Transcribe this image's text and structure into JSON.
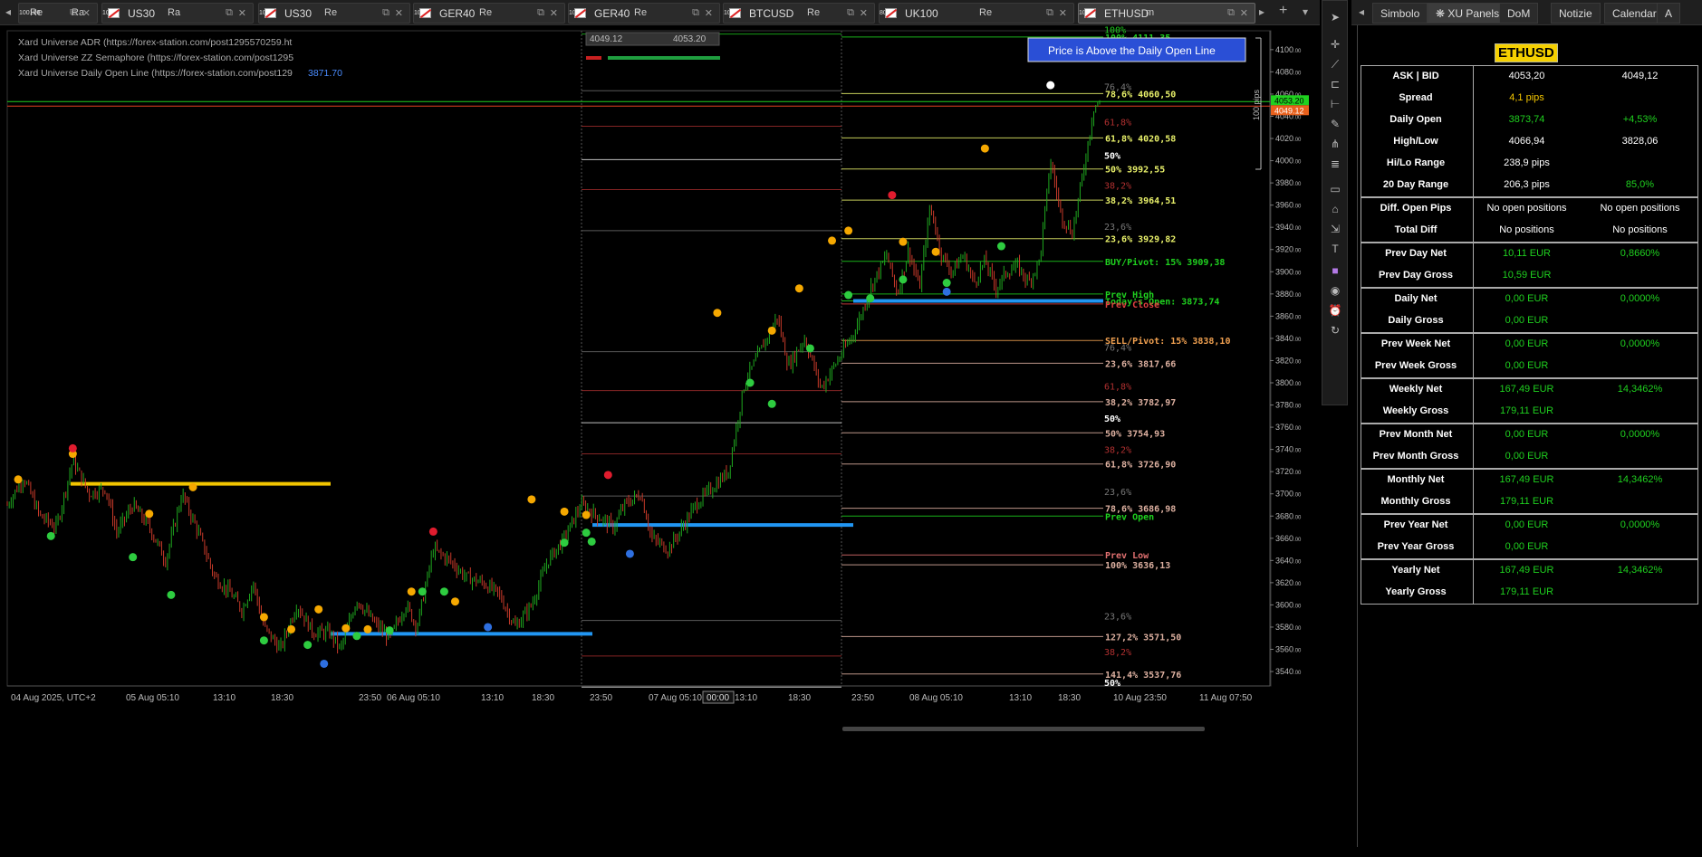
{
  "tabs": [
    {
      "symbol": "",
      "period": "Re",
      "period_sub": "100",
      "period2": "Ra",
      "period2_sub": "100"
    },
    {
      "symbol": "US30",
      "period": "Ra",
      "period_sub": "100",
      "period2": "",
      "period2_sub": ""
    },
    {
      "symbol": "US30",
      "period": "Re",
      "period_sub": "100",
      "period2": "",
      "period2_sub": ""
    },
    {
      "symbol": "GER40",
      "period": "Re",
      "period_sub": "100",
      "period2": "",
      "period2_sub": ""
    },
    {
      "symbol": "GER40",
      "period": "Re",
      "period_sub": "100",
      "period2": "",
      "period2_sub": ""
    },
    {
      "symbol": "BTCUSD",
      "period": "Re",
      "period_sub": "100",
      "period2": "",
      "period2_sub": ""
    },
    {
      "symbol": "UK100",
      "period": "Re",
      "period_sub": "80",
      "period2": "",
      "period2_sub": ""
    },
    {
      "symbol": "ETHUSD",
      "period": "m",
      "period_sub": "10",
      "period2": "",
      "period2_sub": ""
    }
  ],
  "right_tabs": [
    "Simbolo",
    "XU Panels",
    "DoM",
    "Notizie",
    "Calendario",
    "A"
  ],
  "indicators": [
    {
      "name": "Xard Universe ADR (https://forex-station.com/post1295570259.ht",
      "value": ""
    },
    {
      "name": "Xard Universe ZZ Semaphore (https://forex-station.com/post1295",
      "value": ""
    },
    {
      "name": "Xard Universe Daily Open Line (https://forex-station.com/post129",
      "value": "3871.70"
    }
  ],
  "trade_box": {
    "sell": "4049.",
    "sell_sub": "12",
    "buy": "4053.",
    "buy_sub": "20"
  },
  "alert_banner": "Price is Above the Daily Open Line",
  "pips_label": "100 pips",
  "price_tags": {
    "ask": "4053.20",
    "bid": "4049.12"
  },
  "crosshair_time": "00:00",
  "chart_data": {
    "type": "candlestick",
    "symbol": "ETHUSD",
    "timezone": "UTC+2",
    "ylim": [
      3527,
      4117
    ],
    "y_ticks": [
      4100,
      4080,
      4060,
      4040,
      4020,
      4000,
      3980,
      3960,
      3940,
      3920,
      3900,
      3880,
      3860,
      3840,
      3820,
      3800,
      3780,
      3760,
      3740,
      3720,
      3700,
      3680,
      3660,
      3640,
      3620,
      3600,
      3580,
      3560,
      3540
    ],
    "x_ticks": [
      "04 Aug 2025, UTC+2",
      "05 Aug 05:10",
      "13:10",
      "18:30",
      "23:50",
      "06 Aug 05:10",
      "13:10",
      "18:30",
      "23:50",
      "07 Aug 05:10",
      "13:10",
      "18:30",
      "23:50",
      "08 Aug 05:10",
      "13:10",
      "18:30",
      "10 Aug 23:50",
      "11 Aug 07:50"
    ],
    "close_path": [
      [
        0,
        3690
      ],
      [
        0.015,
        3715
      ],
      [
        0.03,
        3680
      ],
      [
        0.045,
        3670
      ],
      [
        0.06,
        3730
      ],
      [
        0.075,
        3700
      ],
      [
        0.09,
        3705
      ],
      [
        0.1,
        3665
      ],
      [
        0.115,
        3690
      ],
      [
        0.13,
        3670
      ],
      [
        0.145,
        3640
      ],
      [
        0.16,
        3700
      ],
      [
        0.175,
        3665
      ],
      [
        0.19,
        3625
      ],
      [
        0.205,
        3610
      ],
      [
        0.215,
        3595
      ],
      [
        0.225,
        3620
      ],
      [
        0.235,
        3580
      ],
      [
        0.25,
        3560
      ],
      [
        0.265,
        3600
      ],
      [
        0.28,
        3575
      ],
      [
        0.295,
        3575
      ],
      [
        0.305,
        3560
      ],
      [
        0.32,
        3605
      ],
      [
        0.335,
        3585
      ],
      [
        0.35,
        3570
      ],
      [
        0.365,
        3600
      ],
      [
        0.375,
        3580
      ],
      [
        0.39,
        3650
      ],
      [
        0.405,
        3640
      ],
      [
        0.42,
        3625
      ],
      [
        0.435,
        3620
      ],
      [
        0.45,
        3610
      ],
      [
        0.465,
        3580
      ],
      [
        0.48,
        3600
      ],
      [
        0.495,
        3640
      ],
      [
        0.51,
        3660
      ],
      [
        0.525,
        3690
      ],
      [
        0.54,
        3680
      ],
      [
        0.555,
        3670
      ],
      [
        0.565,
        3690
      ],
      [
        0.58,
        3700
      ],
      [
        0.59,
        3660
      ],
      [
        0.605,
        3650
      ],
      [
        0.615,
        3665
      ],
      [
        0.63,
        3690
      ],
      [
        0.645,
        3705
      ],
      [
        0.66,
        3720
      ],
      [
        0.675,
        3800
      ],
      [
        0.69,
        3830
      ],
      [
        0.705,
        3860
      ],
      [
        0.715,
        3815
      ],
      [
        0.73,
        3840
      ],
      [
        0.745,
        3795
      ],
      [
        0.76,
        3820
      ],
      [
        0.775,
        3845
      ],
      [
        0.785,
        3870
      ],
      [
        0.79,
        3885
      ],
      [
        0.805,
        3915
      ],
      [
        0.815,
        3880
      ],
      [
        0.825,
        3920
      ],
      [
        0.835,
        3885
      ],
      [
        0.845,
        3960
      ],
      [
        0.855,
        3915
      ],
      [
        0.865,
        3900
      ],
      [
        0.875,
        3915
      ],
      [
        0.885,
        3890
      ],
      [
        0.895,
        3910
      ],
      [
        0.905,
        3885
      ],
      [
        0.915,
        3900
      ],
      [
        0.925,
        3905
      ],
      [
        0.935,
        3890
      ],
      [
        0.945,
        3910
      ],
      [
        0.955,
        4000
      ],
      [
        0.965,
        3950
      ],
      [
        0.975,
        3935
      ],
      [
        0.985,
        3990
      ],
      [
        0.995,
        4050
      ],
      [
        1,
        4052
      ]
    ],
    "yellow_dots": [
      [
        3713,
        "0.01"
      ],
      [
        3736,
        "0.06"
      ],
      [
        3682,
        "0.13"
      ],
      [
        3706,
        "0.17"
      ],
      [
        3589,
        "0.235"
      ],
      [
        3578,
        "0.26"
      ],
      [
        3596,
        "0.285"
      ],
      [
        3579,
        "0.31"
      ],
      [
        3578,
        "0.33"
      ],
      [
        3612,
        "0.37"
      ],
      [
        3603,
        "0.41"
      ],
      [
        3695,
        "0.48"
      ],
      [
        3684,
        "0.51"
      ],
      [
        3681,
        "0.53"
      ],
      [
        3863,
        "0.65"
      ],
      [
        3847,
        "0.7"
      ],
      [
        3885,
        "0.725"
      ],
      [
        3928,
        "0.755"
      ],
      [
        3937,
        "0.77"
      ],
      [
        3927,
        "0.82"
      ],
      [
        3918,
        "0.85"
      ],
      [
        4011,
        "0.895"
      ]
    ],
    "red_dots": [
      [
        3741,
        "0.06"
      ],
      [
        3666,
        "0.39"
      ],
      [
        3717,
        "0.55"
      ],
      [
        3969,
        "0.81"
      ]
    ],
    "green_dots": [
      [
        3662,
        "0.04"
      ],
      [
        3643,
        "0.115"
      ],
      [
        3609,
        "0.15"
      ],
      [
        3568,
        "0.235"
      ],
      [
        3564,
        "0.275"
      ],
      [
        3572,
        "0.32"
      ],
      [
        3577,
        "0.35"
      ],
      [
        3612,
        "0.38"
      ],
      [
        3612,
        "0.4"
      ],
      [
        3656,
        "0.51"
      ],
      [
        3665,
        "0.53"
      ],
      [
        3657,
        "0.535"
      ],
      [
        3800,
        "0.68"
      ],
      [
        3781,
        "0.7"
      ],
      [
        3831,
        "0.735"
      ],
      [
        3879,
        "0.77"
      ],
      [
        3876,
        "0.79"
      ],
      [
        3893,
        "0.82"
      ],
      [
        3890,
        "0.86"
      ],
      [
        3923,
        "0.91"
      ]
    ],
    "blue_dots": [
      [
        3547,
        "0.29"
      ],
      [
        3580,
        "0.44"
      ],
      [
        3646,
        "0.57"
      ],
      [
        3882,
        "0.86"
      ]
    ],
    "white_dots": [
      [
        4068,
        "0.955"
      ]
    ],
    "fib_right": [
      {
        "label": "100% 4111,35",
        "price": 4111.35,
        "color": "#1fd11f"
      },
      {
        "label": "78,6% 4060,50",
        "price": 4060.5,
        "color": "#e8f06a"
      },
      {
        "label": "61,8% 4020,58",
        "price": 4020.58,
        "color": "#e8f06a"
      },
      {
        "label": "50% 3992,55",
        "price": 3992.55,
        "color": "#e8f06a"
      },
      {
        "label": "38,2% 3964,51",
        "price": 3964.51,
        "color": "#e8f06a"
      },
      {
        "label": "23,6% 3929,82",
        "price": 3929.82,
        "color": "#e8f06a"
      },
      {
        "label": "BUY/Pivot: 15% 3909,38",
        "price": 3909.38,
        "color": "#1fd11f"
      },
      {
        "label": "Prev High",
        "price": 3880,
        "color": "#1fd11f"
      },
      {
        "label": "Today's Open: 3873,74",
        "price": 3873.74,
        "color": "#1fd11f"
      },
      {
        "label": "Prev Close",
        "price": 3871,
        "color": "#e04040"
      },
      {
        "label": "SELL/Pivot: 15% 3838,10",
        "price": 3838.1,
        "color": "#f0a050"
      },
      {
        "label": "23,6% 3817,66",
        "price": 3817.66,
        "color": "#ddb0a0"
      },
      {
        "label": "38,2% 3782,97",
        "price": 3782.97,
        "color": "#ddb0a0"
      },
      {
        "label": "50% 3754,93",
        "price": 3754.93,
        "color": "#ddb0a0"
      },
      {
        "label": "61,8% 3726,90",
        "price": 3726.9,
        "color": "#ddb0a0"
      },
      {
        "label": "78,6% 3686,98",
        "price": 3686.98,
        "color": "#ddb0a0"
      },
      {
        "label": "Prev Open",
        "price": 3680,
        "color": "#1fd11f"
      },
      {
        "label": "Prev Low",
        "price": 3645,
        "color": "#e07070"
      },
      {
        "label": "100% 3636,13",
        "price": 3636.13,
        "color": "#ddb0a0"
      },
      {
        "label": "127,2% 3571,50",
        "price": 3571.5,
        "color": "#ddb0a0"
      },
      {
        "label": "141,4% 3537,76",
        "price": 3537.76,
        "color": "#ddb0a0"
      }
    ],
    "fib_left": [
      {
        "label": "100%",
        "price": 4114,
        "color": "#1fd11f"
      },
      {
        "label": "76,4%",
        "price": 4063,
        "color": "#777"
      },
      {
        "label": "61,8%",
        "price": 4031,
        "color": "#b03030"
      },
      {
        "label": "50%",
        "price": 4001,
        "color": "#fff"
      },
      {
        "label": "38,2%",
        "price": 3974,
        "color": "#b03030"
      },
      {
        "label": "23,6%",
        "price": 3937,
        "color": "#777"
      },
      {
        "label": "76,4%",
        "price": 3828,
        "color": "#777"
      },
      {
        "label": "61,8%",
        "price": 3793,
        "color": "#b03030"
      },
      {
        "label": "50%",
        "price": 3764,
        "color": "#fff"
      },
      {
        "label": "38,2%",
        "price": 3736,
        "color": "#b03030"
      },
      {
        "label": "23,6%",
        "price": 3698,
        "color": "#777"
      },
      {
        "label": "23,6%",
        "price": 3586,
        "color": "#777"
      },
      {
        "label": "38,2%",
        "price": 3554,
        "color": "#b03030"
      },
      {
        "label": "50%",
        "price": 3526,
        "color": "#fff"
      }
    ],
    "daily_open_lines": [
      {
        "price": 3709,
        "color": "#f2c500"
      },
      {
        "price": 3574,
        "color": "#2196f3"
      },
      {
        "price": 3672,
        "color": "#2196f3"
      },
      {
        "price": 3873.74,
        "color": "#2196f3"
      }
    ]
  },
  "panel": {
    "title": "ETHUSD",
    "groups": [
      [
        {
          "label": "ASK | BID",
          "v1": "4053,20",
          "v2": "4049,12",
          "c1": "w",
          "c2": "w"
        },
        {
          "label": "Spread",
          "v1": "4,1 pips",
          "v2": "",
          "c1": "y",
          "c2": ""
        },
        {
          "label": "Daily Open",
          "v1": "3873,74",
          "v2": "+4,53%",
          "c1": "g",
          "c2": "g"
        },
        {
          "label": "High/Low",
          "v1": "4066,94",
          "v2": "3828,06",
          "c1": "w",
          "c2": "w"
        },
        {
          "label": "Hi/Lo Range",
          "v1": "238,9 pips",
          "v2": "",
          "c1": "w",
          "c2": ""
        },
        {
          "label": "20 Day Range",
          "v1": "206,3 pips",
          "v2": "85,0%",
          "c1": "w",
          "c2": "g"
        }
      ],
      [
        {
          "label": "Diff. Open Pips",
          "v1": "No open positions",
          "v2": "No open positions",
          "c1": "w",
          "c2": "w"
        },
        {
          "label": "Total Diff",
          "v1": "No positions",
          "v2": "No positions",
          "c1": "w",
          "c2": "w"
        }
      ],
      [
        {
          "label": "Prev Day Net",
          "v1": "10,11 EUR",
          "v2": "0,8660%",
          "c1": "g",
          "c2": "g"
        },
        {
          "label": "Prev Day Gross",
          "v1": "10,59 EUR",
          "v2": "",
          "c1": "g",
          "c2": ""
        }
      ],
      [
        {
          "label": "Daily Net",
          "v1": "0,00 EUR",
          "v2": "0,0000%",
          "c1": "g",
          "c2": "g"
        },
        {
          "label": "Daily Gross",
          "v1": "0,00 EUR",
          "v2": "",
          "c1": "g",
          "c2": ""
        }
      ],
      [
        {
          "label": "Prev Week Net",
          "v1": "0,00 EUR",
          "v2": "0,0000%",
          "c1": "g",
          "c2": "g"
        },
        {
          "label": "Prev Week Gross",
          "v1": "0,00 EUR",
          "v2": "",
          "c1": "g",
          "c2": ""
        }
      ],
      [
        {
          "label": "Weekly Net",
          "v1": "167,49 EUR",
          "v2": "14,3462%",
          "c1": "g",
          "c2": "g"
        },
        {
          "label": "Weekly Gross",
          "v1": "179,11 EUR",
          "v2": "",
          "c1": "g",
          "c2": ""
        }
      ],
      [
        {
          "label": "Prev Month Net",
          "v1": "0,00 EUR",
          "v2": "0,0000%",
          "c1": "g",
          "c2": "g"
        },
        {
          "label": "Prev Month Gross",
          "v1": "0,00 EUR",
          "v2": "",
          "c1": "g",
          "c2": ""
        }
      ],
      [
        {
          "label": "Monthly Net",
          "v1": "167,49 EUR",
          "v2": "14,3462%",
          "c1": "g",
          "c2": "g"
        },
        {
          "label": "Monthly Gross",
          "v1": "179,11 EUR",
          "v2": "",
          "c1": "g",
          "c2": ""
        }
      ],
      [
        {
          "label": "Prev Year Net",
          "v1": "0,00 EUR",
          "v2": "0,0000%",
          "c1": "g",
          "c2": "g"
        },
        {
          "label": "Prev Year Gross",
          "v1": "0,00 EUR",
          "v2": "",
          "c1": "g",
          "c2": ""
        }
      ],
      [
        {
          "label": "Yearly Net",
          "v1": "167,49 EUR",
          "v2": "14,3462%",
          "c1": "g",
          "c2": "g"
        },
        {
          "label": "Yearly Gross",
          "v1": "179,11 EUR",
          "v2": "",
          "c1": "g",
          "c2": ""
        }
      ]
    ]
  }
}
